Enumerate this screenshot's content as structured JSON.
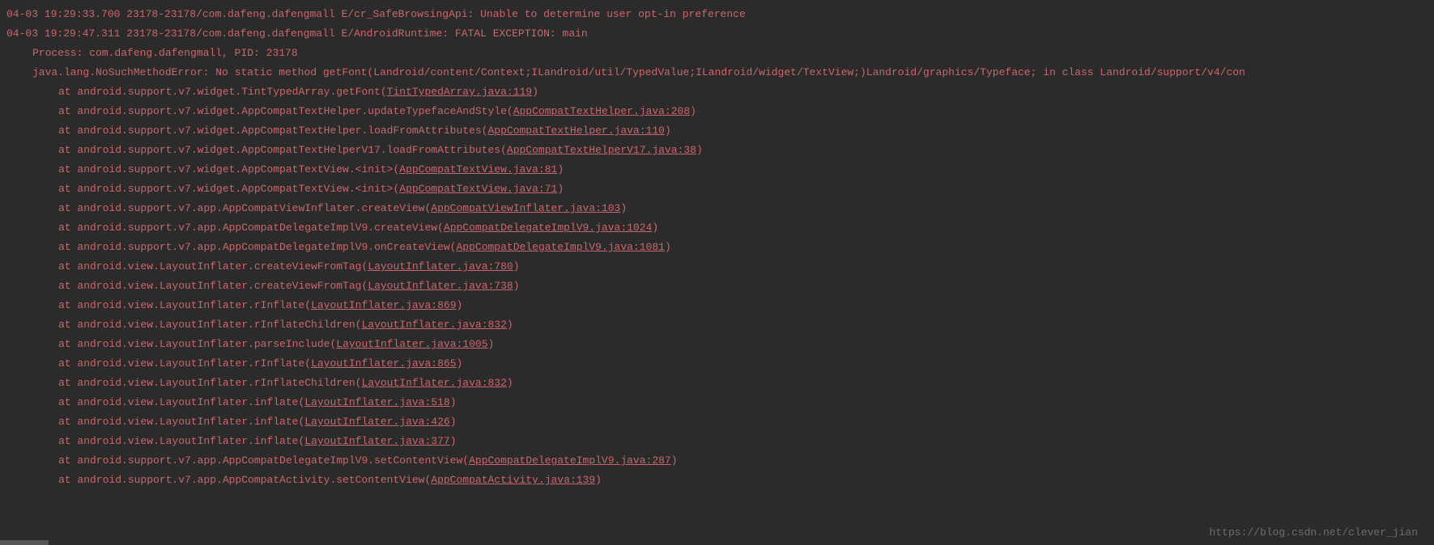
{
  "watermark": "https://blog.csdn.net/clever_jian",
  "log": {
    "lines": [
      {
        "level": "error",
        "indent": 0,
        "pre": "04-03 19:29:33.700 23178-23178/com.dafeng.dafengmall E/cr_SafeBrowsingApi: Unable to determine user opt-in preference"
      },
      {
        "level": "error",
        "indent": 0,
        "pre": "04-03 19:29:47.311 23178-23178/com.dafeng.dafengmall E/AndroidRuntime: FATAL EXCEPTION: main"
      },
      {
        "level": "error",
        "indent": 1,
        "pre": "Process: com.dafeng.dafengmall, PID: 23178"
      },
      {
        "level": "error",
        "indent": 1,
        "pre": "java.lang.NoSuchMethodError: No static method getFont(Landroid/content/Context;ILandroid/util/TypedValue;ILandroid/widget/TextView;)Landroid/graphics/Typeface; in class Landroid/support/v4/con"
      },
      {
        "level": "error",
        "indent": 2,
        "pre": "at android.support.v7.widget.TintTypedArray.getFont(",
        "link": "TintTypedArray.java:119",
        "post": ")"
      },
      {
        "level": "error",
        "indent": 2,
        "pre": "at android.support.v7.widget.AppCompatTextHelper.updateTypefaceAndStyle(",
        "link": "AppCompatTextHelper.java:208",
        "post": ")"
      },
      {
        "level": "error",
        "indent": 2,
        "pre": "at android.support.v7.widget.AppCompatTextHelper.loadFromAttributes(",
        "link": "AppCompatTextHelper.java:110",
        "post": ")"
      },
      {
        "level": "error",
        "indent": 2,
        "pre": "at android.support.v7.widget.AppCompatTextHelperV17.loadFromAttributes(",
        "link": "AppCompatTextHelperV17.java:38",
        "post": ")"
      },
      {
        "level": "error",
        "indent": 2,
        "pre": "at android.support.v7.widget.AppCompatTextView.<init>(",
        "link": "AppCompatTextView.java:81",
        "post": ")"
      },
      {
        "level": "error",
        "indent": 2,
        "pre": "at android.support.v7.widget.AppCompatTextView.<init>(",
        "link": "AppCompatTextView.java:71",
        "post": ")"
      },
      {
        "level": "error",
        "indent": 2,
        "pre": "at android.support.v7.app.AppCompatViewInflater.createView(",
        "link": "AppCompatViewInflater.java:103",
        "post": ")"
      },
      {
        "level": "error",
        "indent": 2,
        "pre": "at android.support.v7.app.AppCompatDelegateImplV9.createView(",
        "link": "AppCompatDelegateImplV9.java:1024",
        "post": ")"
      },
      {
        "level": "error",
        "indent": 2,
        "pre": "at android.support.v7.app.AppCompatDelegateImplV9.onCreateView(",
        "link": "AppCompatDelegateImplV9.java:1081",
        "post": ")"
      },
      {
        "level": "error",
        "indent": 2,
        "pre": "at android.view.LayoutInflater.createViewFromTag(",
        "link": "LayoutInflater.java:780",
        "post": ")"
      },
      {
        "level": "error",
        "indent": 2,
        "pre": "at android.view.LayoutInflater.createViewFromTag(",
        "link": "LayoutInflater.java:738",
        "post": ")"
      },
      {
        "level": "error",
        "indent": 2,
        "pre": "at android.view.LayoutInflater.rInflate(",
        "link": "LayoutInflater.java:869",
        "post": ")"
      },
      {
        "level": "error",
        "indent": 2,
        "pre": "at android.view.LayoutInflater.rInflateChildren(",
        "link": "LayoutInflater.java:832",
        "post": ")"
      },
      {
        "level": "error",
        "indent": 2,
        "pre": "at android.view.LayoutInflater.parseInclude(",
        "link": "LayoutInflater.java:1005",
        "post": ")"
      },
      {
        "level": "error",
        "indent": 2,
        "pre": "at android.view.LayoutInflater.rInflate(",
        "link": "LayoutInflater.java:865",
        "post": ")"
      },
      {
        "level": "error",
        "indent": 2,
        "pre": "at android.view.LayoutInflater.rInflateChildren(",
        "link": "LayoutInflater.java:832",
        "post": ")"
      },
      {
        "level": "error",
        "indent": 2,
        "pre": "at android.view.LayoutInflater.inflate(",
        "link": "LayoutInflater.java:518",
        "post": ")"
      },
      {
        "level": "error",
        "indent": 2,
        "pre": "at android.view.LayoutInflater.inflate(",
        "link": "LayoutInflater.java:426",
        "post": ")"
      },
      {
        "level": "error",
        "indent": 2,
        "pre": "at android.view.LayoutInflater.inflate(",
        "link": "LayoutInflater.java:377",
        "post": ")"
      },
      {
        "level": "error",
        "indent": 2,
        "pre": "at android.support.v7.app.AppCompatDelegateImplV9.setContentView(",
        "link": "AppCompatDelegateImplV9.java:287",
        "post": ")"
      },
      {
        "level": "error",
        "indent": 2,
        "pre": "at android.support.v7.app.AppCompatActivity.setContentView(",
        "link": "AppCompatActivity.java:139",
        "post": ")"
      }
    ]
  }
}
